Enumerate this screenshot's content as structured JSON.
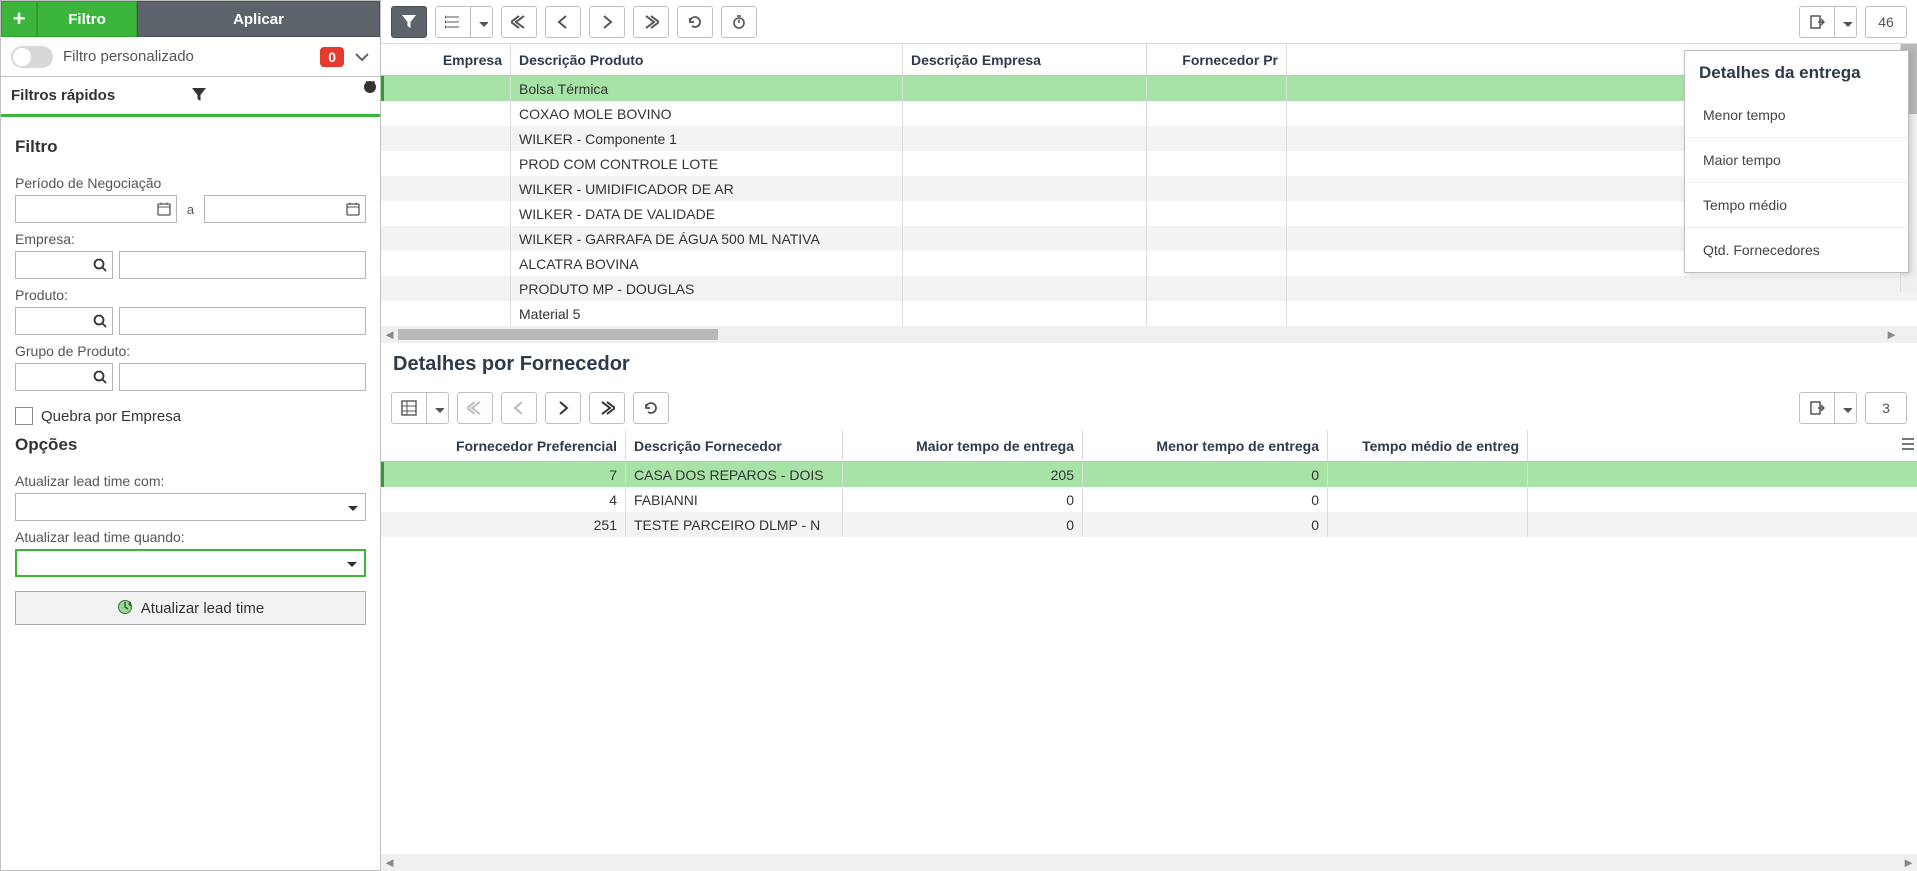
{
  "sidebar": {
    "btn_plus": "+",
    "btn_filtro": "Filtro",
    "btn_apply": "Aplicar",
    "custom_filter_label": "Filtro personalizado",
    "custom_filter_badge": "0",
    "quick_filters_label": "Filtros rápidos",
    "section_filter": "Filtro",
    "lbl_periodo": "Período de Negociação",
    "sep_a": "a",
    "lbl_empresa": "Empresa:",
    "lbl_produto": "Produto:",
    "lbl_grupo": "Grupo de Produto:",
    "chk_quebra": "Quebra por Empresa",
    "section_options": "Opções",
    "lbl_leadtime_com": "Atualizar lead time com:",
    "lbl_leadtime_quando": "Atualizar lead time quando:",
    "btn_update": "Atualizar lead time"
  },
  "topgrid": {
    "count": "46",
    "headers": {
      "empresa": "Empresa",
      "desc_prod": "Descrição Produto",
      "desc_emp": "Descrição Empresa",
      "forn": "Fornecedor Pr"
    },
    "rows": [
      {
        "p": "Bolsa Térmica"
      },
      {
        "p": "COXAO MOLE BOVINO"
      },
      {
        "p": "WILKER - Componente 1"
      },
      {
        "p": "PROD COM CONTROLE LOTE"
      },
      {
        "p": "WILKER - UMIDIFICADOR DE AR"
      },
      {
        "p": "WILKER - DATA DE VALIDADE"
      },
      {
        "p": "WILKER - GARRAFA DE ÁGUA 500 ML NATIVA"
      },
      {
        "p": "ALCATRA BOVINA"
      },
      {
        "p": "PRODUTO MP - DOUGLAS"
      },
      {
        "p": "Material 5"
      }
    ]
  },
  "detail_title": "Detalhes por Fornecedor",
  "botgrid": {
    "count": "3",
    "headers": {
      "fp": "Fornecedor Preferencial",
      "desc": "Descrição Fornecedor",
      "mai": "Maior tempo de entrega",
      "men": "Menor tempo de entrega",
      "med": "Tempo médio de entreg"
    },
    "rows": [
      {
        "fp": "7",
        "desc": "CASA DOS REPAROS - DOIS",
        "mai": "205",
        "men": "0"
      },
      {
        "fp": "4",
        "desc": "FABIANNI",
        "mai": "0",
        "men": "0"
      },
      {
        "fp": "251",
        "desc": "TESTE PARCEIRO DLMP - N",
        "mai": "0",
        "men": "0"
      }
    ]
  },
  "float": {
    "title": "Detalhes da entrega",
    "items": [
      "Menor tempo",
      "Maior tempo",
      "Tempo médio",
      "Qtd. Fornecedores"
    ]
  }
}
